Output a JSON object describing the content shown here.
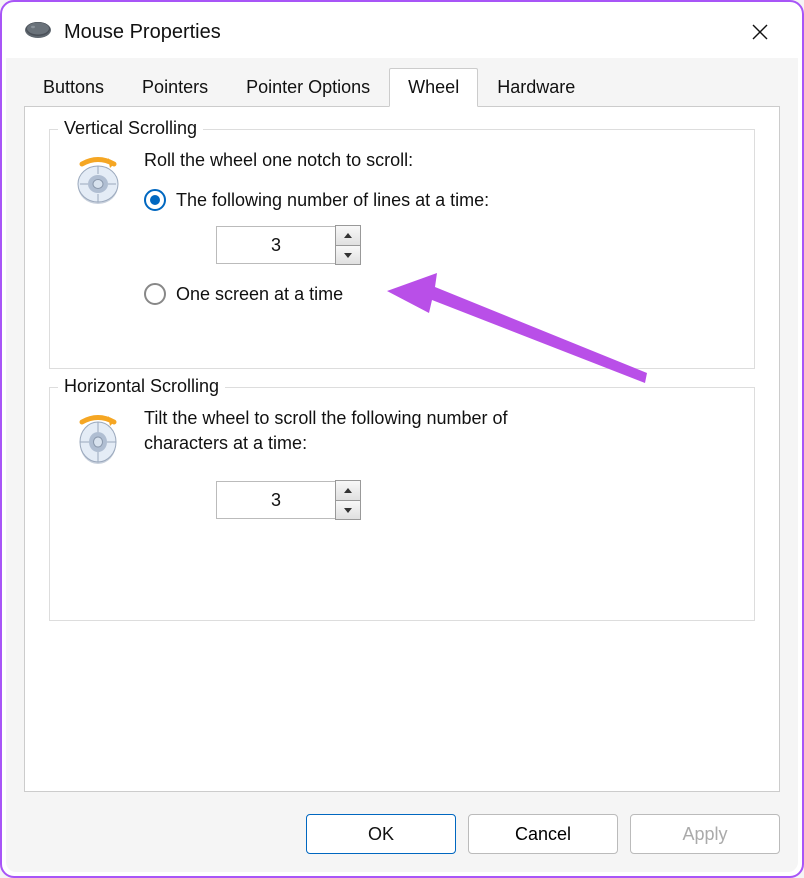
{
  "window": {
    "title": "Mouse Properties"
  },
  "tabs": {
    "items": [
      {
        "label": "Buttons"
      },
      {
        "label": "Pointers"
      },
      {
        "label": "Pointer Options"
      },
      {
        "label": "Wheel"
      },
      {
        "label": "Hardware"
      }
    ],
    "active_index": 3
  },
  "vertical": {
    "group_label": "Vertical Scrolling",
    "description": "Roll the wheel one notch to scroll:",
    "option_lines_label": "The following number of lines at a time:",
    "option_screen_label": "One screen at a time",
    "selected": "lines",
    "lines_value": "3"
  },
  "horizontal": {
    "group_label": "Horizontal Scrolling",
    "description": "Tilt the wheel to scroll the following number of characters at a time:",
    "chars_value": "3"
  },
  "footer": {
    "ok": "OK",
    "cancel": "Cancel",
    "apply": "Apply"
  }
}
